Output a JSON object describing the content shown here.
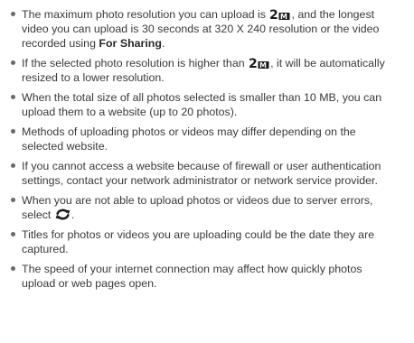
{
  "notes": [
    {
      "t1": "The maximum photo resolution you can upload is",
      "t2": ", and the longest video you can upload is 30 seconds at 320 X 240 resolution or the video recorded using",
      "bold": "For Sharing",
      "t3": "."
    },
    {
      "t1": "If the selected photo resolution is higher than",
      "t2": ", it will be automatically resized to a lower resolution."
    },
    {
      "t1": "When the total size of all photos selected is smaller than 10 MB, you can upload them to a website (up to 20 photos)."
    },
    {
      "t1": "Methods of uploading photos or videos may differ depending on the selected website."
    },
    {
      "t1": "If you cannot access a website because of firewall or user authentication settings, contact your network administrator or network service provider."
    },
    {
      "t1": "When you are not able to upload photos or videos due to server errors, select",
      "t2": "."
    },
    {
      "t1": "Titles for photos or videos you are uploading could be the date they are captured."
    },
    {
      "t1": "The speed of your internet connection may affect how quickly photos upload or web pages open."
    }
  ],
  "icons": {
    "resolution": "resolution-2m-icon",
    "refresh": "refresh-icon"
  },
  "colors": {
    "text": "#3a3a3a",
    "icon": "#1a1a1a"
  }
}
